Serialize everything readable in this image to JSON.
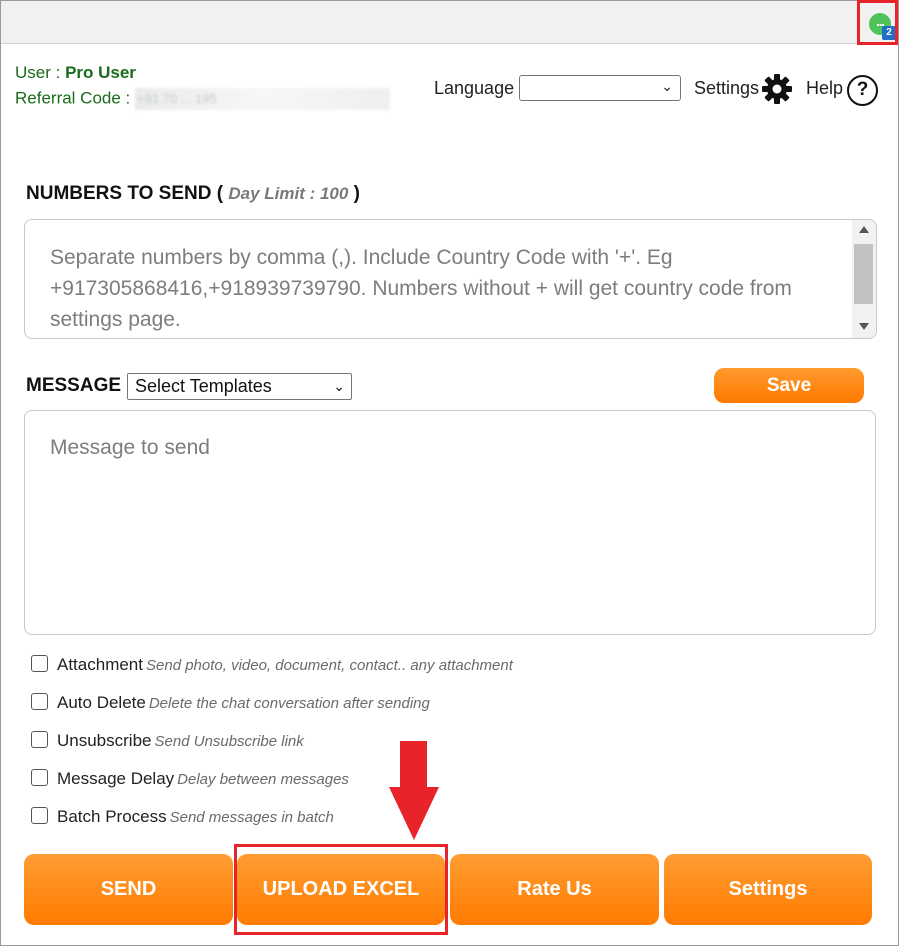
{
  "extension": {
    "badge_count": "2",
    "dots": "..."
  },
  "user": {
    "label": "User : ",
    "value": "Pro User"
  },
  "referral": {
    "label": "Referral Code : ",
    "value": "+91 70 ... 195"
  },
  "header": {
    "language_label": "Language",
    "language_value": "",
    "settings_label": "Settings",
    "help_label": "Help",
    "help_symbol": "?"
  },
  "numbers": {
    "title": "NUMBERS TO SEND",
    "open_paren": " ( ",
    "limit": "Day Limit : 100",
    "close_paren": " )",
    "placeholder": "Separate numbers by comma (,). Include Country Code with '+'. Eg +917305868416,+918939739790. Numbers without + will get country code from settings page."
  },
  "message": {
    "title": "MESSAGE",
    "template_select": "Select Templates",
    "save_label": "Save",
    "placeholder": "Message to send"
  },
  "options": [
    {
      "label": "Attachment",
      "desc": "Send photo, video, document, contact.. any attachment",
      "checked": false
    },
    {
      "label": "Auto Delete",
      "desc": "Delete the chat conversation after sending",
      "checked": false
    },
    {
      "label": "Unsubscribe",
      "desc": "Send Unsubscribe link",
      "checked": false
    },
    {
      "label": "Message Delay",
      "desc": "Delay between messages",
      "checked": false
    },
    {
      "label": "Batch Process",
      "desc": "Send messages in batch",
      "checked": false
    }
  ],
  "buttons": {
    "send": "SEND",
    "upload_excel": "UPLOAD EXCEL",
    "rate_us": "Rate Us",
    "settings": "Settings"
  },
  "colors": {
    "accent_orange": "#ff8a14",
    "highlight_red": "#e8232a",
    "user_green": "#1a6b1a"
  }
}
